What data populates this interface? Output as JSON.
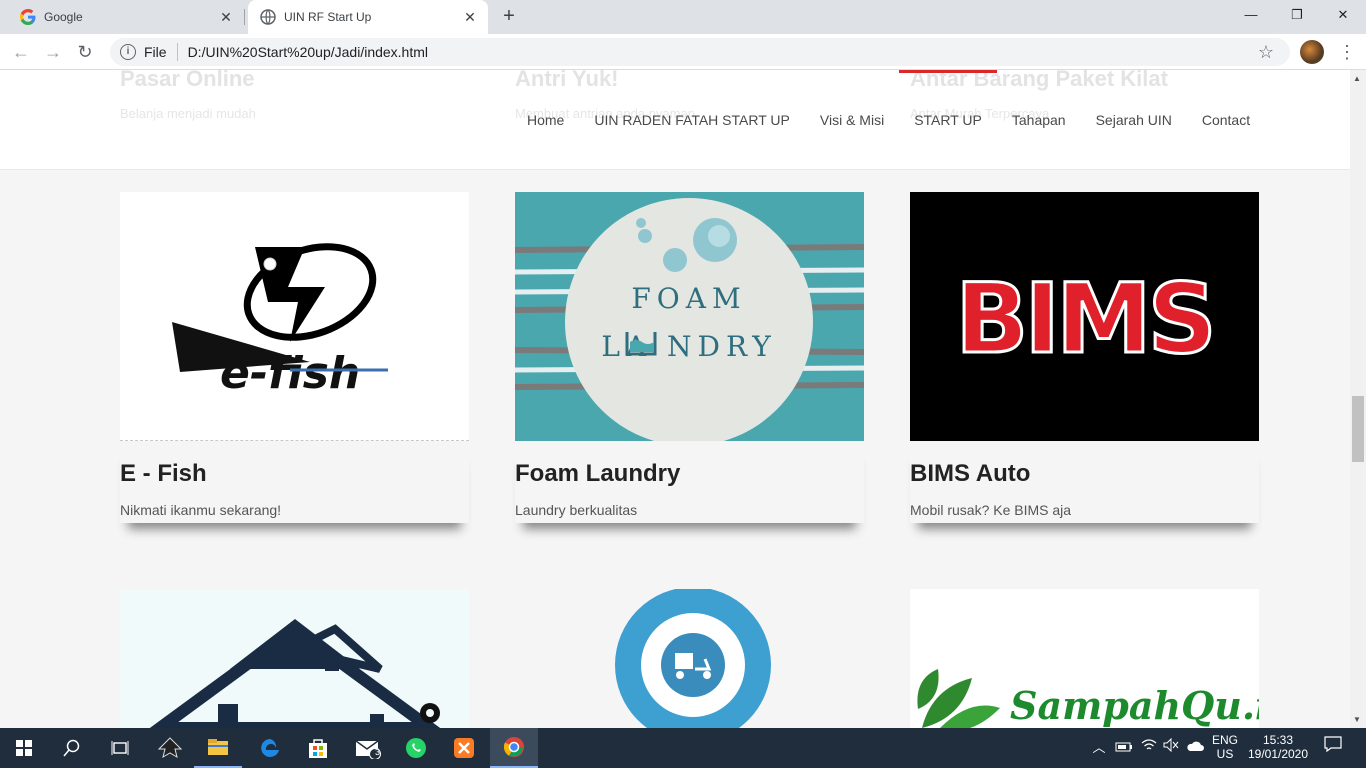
{
  "browser": {
    "tabs": [
      {
        "title": "Google",
        "icon": "google-g-icon"
      },
      {
        "title": "UIN RF Start Up",
        "icon": "globe-icon"
      }
    ],
    "address": {
      "scheme_label": "File",
      "url": "D:/UIN%20Start%20up/Jadi/index.html"
    }
  },
  "site": {
    "ghost_cards": [
      {
        "title": "Pasar Online",
        "desc": "Belanja menjadi mudah"
      },
      {
        "title": "Antri Yuk!",
        "desc": "Membuat antrian anda nyaman"
      },
      {
        "title": "Antar Barang Paket Kilat",
        "desc": "Antar Murah Terpercaya"
      }
    ],
    "nav": [
      {
        "label": "Home",
        "active": false
      },
      {
        "label": "UIN RADEN FATAH START UP",
        "active": false
      },
      {
        "label": "Visi & Misi",
        "active": false
      },
      {
        "label": "START UP",
        "active": true
      },
      {
        "label": "Tahapan",
        "active": false
      },
      {
        "label": "Sejarah UIN",
        "active": false
      },
      {
        "label": "Contact",
        "active": false
      }
    ],
    "cards": [
      {
        "title": "E - Fish",
        "desc": "Nikmati ikanmu sekarang!",
        "logo_text": "e-fish"
      },
      {
        "title": "Foam Laundry",
        "desc": "Laundry berkualitas",
        "logo_text_top": "FOAM",
        "logo_text_bottom": "LA  NDRY"
      },
      {
        "title": "BIMS Auto",
        "desc": "Mobil rusak? Ke BIMS aja",
        "logo_text": "BIMS"
      }
    ],
    "second_row": [
      {
        "logo": "house-logo"
      },
      {
        "logo": "delivery-pin-logo"
      },
      {
        "logo_text": "SampahQu.id"
      }
    ]
  },
  "taskbar": {
    "pinned": [
      "windows-start-icon",
      "search-icon",
      "task-view-icon",
      "inkscape-icon",
      "file-explorer-icon",
      "edge-icon",
      "store-icon",
      "mail-icon",
      "whatsapp-icon",
      "xampp-icon",
      "chrome-icon"
    ],
    "mail_badge": "3",
    "tray": {
      "lang_top": "ENG",
      "lang_bottom": "US",
      "time": "15:33",
      "date": "19/01/2020"
    }
  },
  "colors": {
    "accent_red": "#d8282a",
    "taskbar": "#1f2d3d",
    "laundry_teal": "#4aa7ae",
    "bims_red": "#e0202a"
  }
}
